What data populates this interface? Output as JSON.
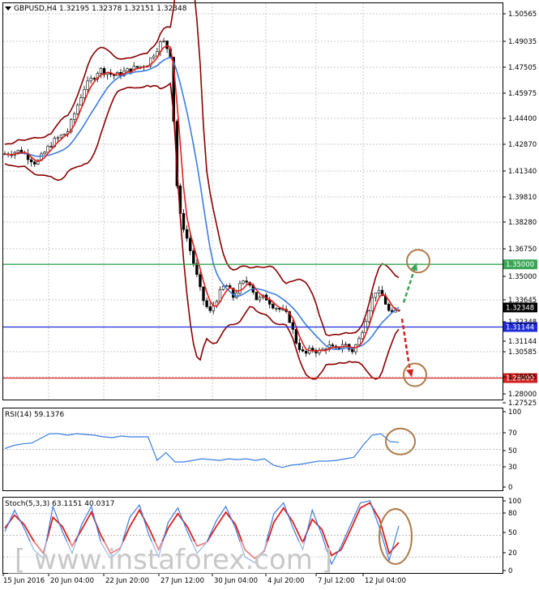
{
  "chart_data": [
    {
      "type": "candlestick",
      "title": "GBPUSD,H4 1.32195 1.32378 1.32151 1.32348",
      "symbol": "GBPUSD",
      "timeframe": "H4",
      "ohlc": {
        "open": 1.32195,
        "high": 1.32378,
        "low": 1.32151,
        "close": 1.32348
      },
      "ylim": [
        1.2668,
        1.5107
      ],
      "y_ticks": [
        "1.50565",
        "1.49035",
        "1.47505",
        "1.45975",
        "1.44400",
        "1.42870",
        "1.41340",
        "1.39810",
        "1.38280",
        "1.36750",
        "1.35000",
        "1.33645",
        "1.32348",
        "1.31144",
        "1.30585",
        "1.29055",
        "1.28000",
        "1.27525"
      ],
      "x_ticks": [
        "15 Jun 2016",
        "20 Jun 04:00",
        "22 Jun 20:00",
        "27 Jun 12:00",
        "30 Jun 04:00",
        "4 Jul 20:00",
        "7 Jul 12:00",
        "12 Jul 04:00"
      ],
      "current_price": "1.32348",
      "levels": [
        {
          "label": "1.35000",
          "value": 1.35,
          "color": "#3aa655"
        },
        {
          "label": "1.31144",
          "value": 1.31144,
          "color": "#1f2bd6"
        },
        {
          "label": "1.28000",
          "value": 1.28,
          "color": "#d22020"
        }
      ],
      "close_path": [
        [
          0,
          1.418
        ],
        [
          4,
          1.42
        ],
        [
          8,
          1.412
        ],
        [
          12,
          1.425
        ],
        [
          16,
          1.432
        ],
        [
          20,
          1.458
        ],
        [
          24,
          1.47
        ],
        [
          28,
          1.466
        ],
        [
          32,
          1.47
        ],
        [
          36,
          1.473
        ],
        [
          40,
          1.488
        ],
        [
          42,
          1.48
        ],
        [
          44,
          1.384
        ],
        [
          46,
          1.368
        ],
        [
          48,
          1.35
        ],
        [
          50,
          1.33
        ],
        [
          52,
          1.32
        ],
        [
          54,
          1.33
        ],
        [
          56,
          1.338
        ],
        [
          58,
          1.33
        ],
        [
          60,
          1.338
        ],
        [
          62,
          1.34
        ],
        [
          64,
          1.328
        ],
        [
          66,
          1.33
        ],
        [
          68,
          1.325
        ],
        [
          70,
          1.322
        ],
        [
          72,
          1.318
        ],
        [
          74,
          1.302
        ],
        [
          76,
          1.294
        ],
        [
          78,
          1.298
        ],
        [
          80,
          1.296
        ],
        [
          82,
          1.3
        ],
        [
          84,
          1.297
        ],
        [
          86,
          1.302
        ],
        [
          88,
          1.296
        ],
        [
          90,
          1.304
        ],
        [
          92,
          1.32
        ],
        [
          94,
          1.334
        ],
        [
          96,
          1.33
        ],
        [
          98,
          1.318
        ],
        [
          100,
          1.323
        ]
      ],
      "series": [
        {
          "color": "#e0201c",
          "role": "fast moving average"
        },
        {
          "color": "#3d7de0",
          "role": "slow moving average"
        },
        {
          "color": "#8b0000",
          "role": "bollinger bands"
        }
      ]
    },
    {
      "type": "line",
      "title": "RSI(14) 59.1376",
      "indicator": "RSI(14)",
      "last_value": 59.1376,
      "ylim": [
        0,
        100
      ],
      "y_ticks": [
        "100",
        "70",
        "50",
        "30",
        "0"
      ],
      "levels": [
        70,
        50,
        30
      ],
      "color": "#3d7de0",
      "values": [
        51,
        55,
        57,
        58,
        64,
        70,
        70,
        68,
        70,
        69,
        68,
        66,
        65,
        67,
        66,
        66,
        66,
        36,
        46,
        34,
        34,
        36,
        38,
        37,
        36,
        38,
        37,
        38,
        36,
        38,
        30,
        27,
        30,
        31,
        33,
        35,
        35,
        36,
        38,
        40,
        55,
        68,
        70,
        60,
        59
      ]
    },
    {
      "type": "line",
      "title": "Stoch(5,3,3) 63.1151 40.0317",
      "indicator": "Stoch(5,3,3)",
      "main_value": 63.1151,
      "signal_value": 40.0317,
      "ylim": [
        0,
        100
      ],
      "y_ticks": [
        "100",
        "80",
        "50",
        "20",
        "0"
      ],
      "levels": [
        80,
        50,
        20
      ],
      "main_color": "#3d7de0",
      "signal_color": "#e0201c",
      "main": [
        55,
        85,
        60,
        30,
        18,
        90,
        55,
        25,
        65,
        90,
        40,
        18,
        30,
        75,
        92,
        50,
        20,
        68,
        88,
        55,
        25,
        40,
        70,
        90,
        60,
        20,
        12,
        30,
        80,
        95,
        60,
        30,
        85,
        50,
        10,
        35,
        65,
        95,
        98,
        60,
        15,
        63
      ],
      "signal": [
        60,
        78,
        65,
        42,
        25,
        75,
        62,
        35,
        58,
        82,
        50,
        25,
        32,
        62,
        85,
        60,
        30,
        60,
        80,
        62,
        35,
        40,
        62,
        82,
        65,
        30,
        18,
        28,
        68,
        88,
        68,
        40,
        72,
        58,
        22,
        30,
        58,
        88,
        95,
        72,
        25,
        40
      ]
    }
  ],
  "watermark": "[ www.instaforex.com ]"
}
